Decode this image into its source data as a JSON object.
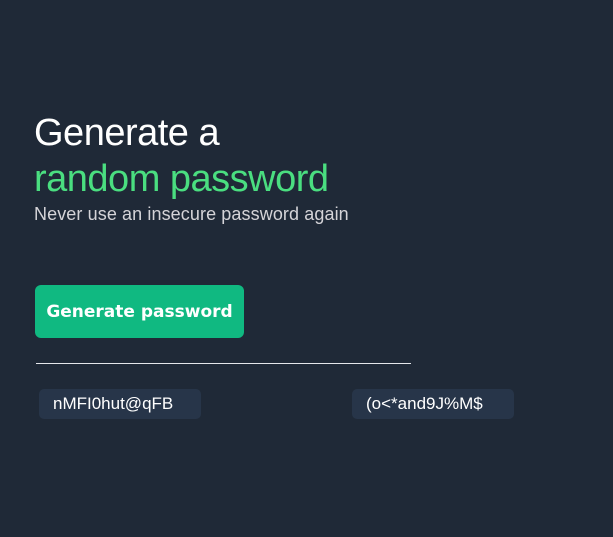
{
  "hero": {
    "title_line1": "Generate a",
    "title_line2": "random password",
    "subtitle": "Never use an insecure password again"
  },
  "actions": {
    "generate_label": "Generate password"
  },
  "passwords": [
    "nMFI0hut@qFB",
    "(o<*and9J%M$"
  ],
  "colors": {
    "background": "#1f2937",
    "accent": "#4ade80",
    "button": "#10b981",
    "password_chip": "#273549"
  }
}
